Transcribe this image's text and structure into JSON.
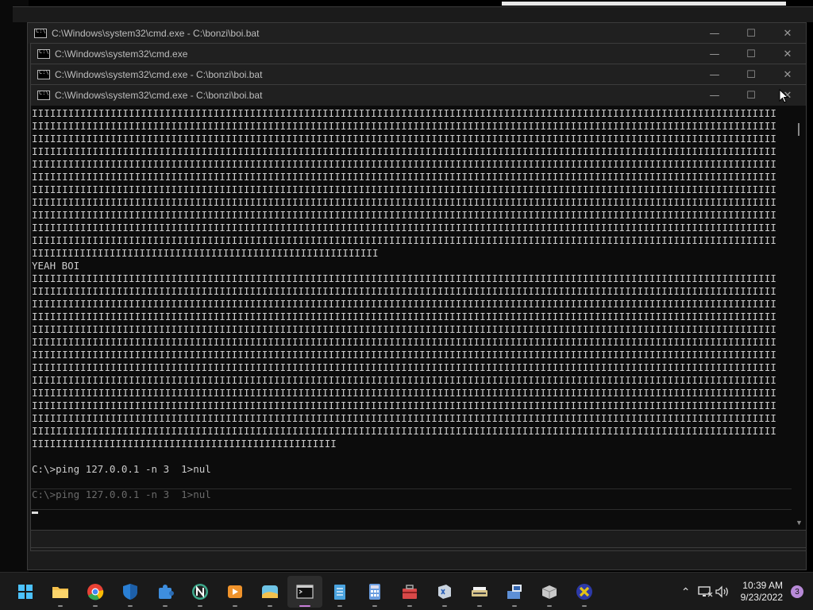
{
  "windows": [
    {
      "title": "C:\\Windows\\system32\\cmd.exe - C:\\bonzi\\boi.bat"
    },
    {
      "title": "C:\\Windows\\system32\\cmd.exe"
    },
    {
      "title": "C:\\Windows\\system32\\cmd.exe - C:\\bonzi\\boi.bat"
    },
    {
      "title": "C:\\Windows\\system32\\cmd.exe - C:\\bonzi\\boi.bat"
    }
  ],
  "window_controls": {
    "minimize": "—",
    "maximize": "☐",
    "close": "✕"
  },
  "console": {
    "fill_char_line": "IIIIIIIIIIIIIIIIIIIIIIIIIIIIIIIIIIIIIIIIIIIIIIIIIIIIIIIIIIIIIIIIIIIIIIIIIIIIIIIIIIIIIIIIIIIIIIIIIIIIIIIIIIIIIIIIIIIIIIIIIII",
    "partial_top": "IIIIIIIIIIIIIIIIIIIIIIIIIIIIIIIIIIIIIIIIIIIIIIIIIIIIIIIIII",
    "yeah_line": "YEAH BOI",
    "partial_bottom": "IIIIIIIIIIIIIIIIIIIIIIIIIIIIIIIIIIIIIIIIIIIIIIIIIII",
    "prompt_line": "C:\\>ping 127.0.0.1 -n 3  1>nul",
    "ghost_prompt_line": "C:\\>ping 127.0.0.1 -n 3  1>nul"
  },
  "taskbar": {
    "apps": [
      {
        "name": "start-icon",
        "color": "#4cc2ff"
      },
      {
        "name": "file-explorer-icon",
        "color": "#f6c04b"
      },
      {
        "name": "chrome-icon",
        "color": "#e94235"
      },
      {
        "name": "windows-security-icon",
        "color": "#2a7fd4"
      },
      {
        "name": "puzzle-app-icon",
        "color": "#3e8ede"
      },
      {
        "name": "n-app-icon",
        "color": "#3da88b"
      },
      {
        "name": "media-player-icon",
        "color": "#f0932b"
      },
      {
        "name": "photos-icon",
        "color": "#6ec4e6"
      },
      {
        "name": "cmd-icon",
        "color": "#cccccc"
      },
      {
        "name": "notepad-icon",
        "color": "#4aa3df"
      },
      {
        "name": "calculator-icon",
        "color": "#6b9ee0"
      },
      {
        "name": "toolbox-icon",
        "color": "#d94848"
      },
      {
        "name": "xp-app-icon",
        "color": "#c9d3df"
      },
      {
        "name": "scanner-icon",
        "color": "#d8c58a"
      },
      {
        "name": "network-app-icon",
        "color": "#5d8fd6"
      },
      {
        "name": "package-icon",
        "color": "#c9c9c9"
      },
      {
        "name": "x-app-icon",
        "color": "#e3c316"
      }
    ],
    "clock_time": "10:39 AM",
    "clock_date": "9/23/2022",
    "notification_count": "3"
  }
}
